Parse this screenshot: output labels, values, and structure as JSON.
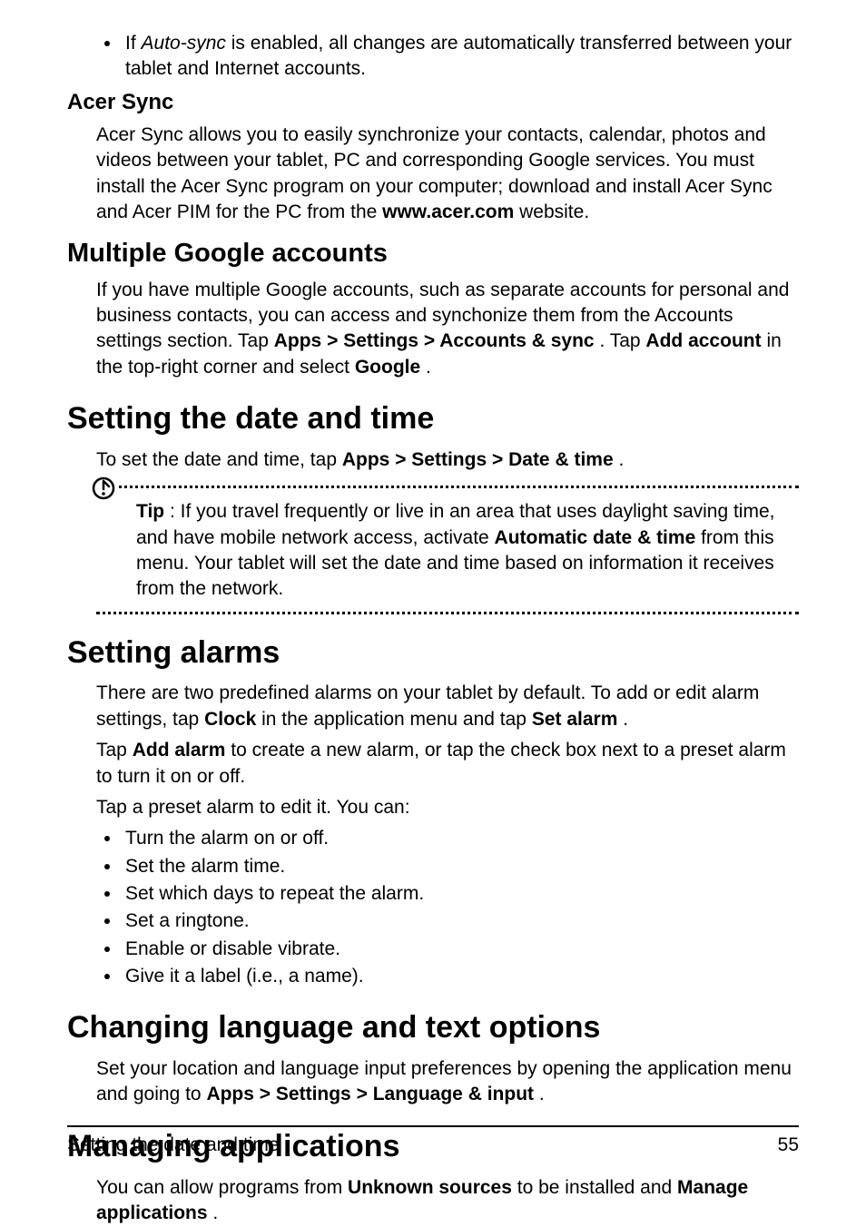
{
  "autosync_bullet": {
    "prefix": "If ",
    "term": "Auto-sync",
    "suffix": " is enabled, all changes are automatically transferred between your tablet and Internet accounts."
  },
  "acer_sync": {
    "heading": "Acer Sync",
    "body_pre": "Acer Sync allows you to easily synchronize your contacts, calendar, photos and videos between your tablet, PC and corresponding Google services. You must install the Acer Sync program on your computer; download and install Acer Sync and Acer PIM for the PC from the ",
    "link": "www.acer.com",
    "body_post": " website."
  },
  "multi_google": {
    "heading": "Multiple Google accounts",
    "body_pre": "If you have multiple Google accounts, such as separate accounts for personal and business contacts, you can access and synchonize them from the Accounts settings section. Tap ",
    "path1": "Apps",
    "sep": " > ",
    "path2": "Settings",
    "path3": "Accounts & sync",
    "mid": ". Tap ",
    "add_account": "Add account",
    "mid2": " in the top-right corner and select ",
    "google": "Google",
    "end": "."
  },
  "datetime": {
    "heading": "Setting the date and time",
    "body_pre": "To set the date and time, tap ",
    "path1": "Apps",
    "sep": " > ",
    "path2": "Settings",
    "path3": "Date & time",
    "end": ".",
    "tip_label": "Tip",
    "tip_body_pre": ": If you travel frequently or live in an area that uses daylight saving time, and have mobile network access, activate ",
    "tip_bold": "Automatic date & time",
    "tip_body_post": " from this menu. Your tablet will set the date and time based on information it receives from the network."
  },
  "alarms": {
    "heading": "Setting alarms",
    "p1_pre": "There are two predefined alarms on your tablet by default. To add or edit alarm settings, tap ",
    "p1_b1": "Clock",
    "p1_mid": " in the application menu and tap ",
    "p1_b2": "Set alarm",
    "p1_end": ".",
    "p2_pre": "Tap ",
    "p2_b": "Add alarm",
    "p2_post": " to create a new alarm, or tap the check box next to a preset alarm to turn it on or off.",
    "p3": "Tap a preset alarm to edit it. You can:",
    "items": [
      "Turn the alarm on or off.",
      "Set the alarm time.",
      "Set which days to repeat the alarm.",
      "Set a ringtone.",
      "Enable or disable vibrate.",
      "Give it a label (i.e., a name)."
    ]
  },
  "lang": {
    "heading": "Changing language and text options",
    "body_pre": "Set your location and language input preferences by opening the application menu and going to ",
    "path1": "Apps",
    "sep": " > ",
    "path2": "Settings",
    "path3": "Language & input",
    "end": "."
  },
  "apps": {
    "heading": "Managing applications",
    "body_pre": "You can allow programs from ",
    "b1": "Unknown sources",
    "mid": " to be installed and ",
    "b2": "Manage applications",
    "end": "."
  },
  "footer": {
    "title": "Setting the date and time",
    "page": "55"
  }
}
